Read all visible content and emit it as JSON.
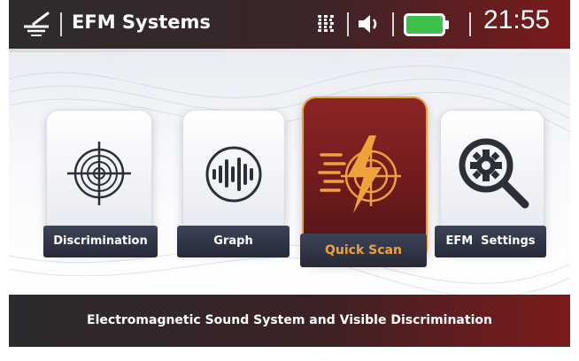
{
  "header": {
    "title": "EFM Systems",
    "clock": "21:55",
    "icons": [
      "metal-detector-icon",
      "signal-strength-icon",
      "volume-icon",
      "battery-icon"
    ],
    "battery_color": "#3cc04a"
  },
  "menu": {
    "items": [
      {
        "label": "Discrimination",
        "icon": "crosshair-icon"
      },
      {
        "label": "Graph",
        "icon": "waveform-icon"
      },
      {
        "label": "Quick Scan",
        "icon": "lightning-radar-icon",
        "selected": true
      },
      {
        "label": "EFM  Settings",
        "icon": "gear-magnifier-icon"
      }
    ]
  },
  "footer": {
    "text": "Electromagnetic Sound System and Visible Discrimination"
  },
  "colors": {
    "header_dark": "#2e2b2d",
    "header_red": "#7a1a1c",
    "accent_orange": "#f0a23a",
    "label_bg": "#2b3040"
  }
}
